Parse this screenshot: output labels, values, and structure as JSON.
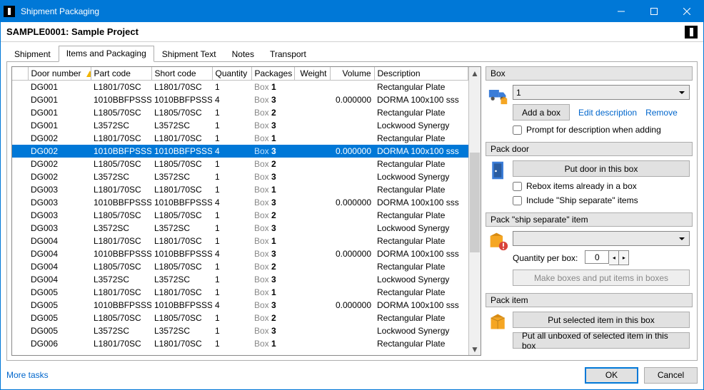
{
  "window": {
    "title": "Shipment Packaging"
  },
  "project": {
    "label": "SAMPLE0001: Sample Project"
  },
  "tabs": {
    "shipment": "Shipment",
    "items": "Items and Packaging",
    "text": "Shipment Text",
    "notes": "Notes",
    "transport": "Transport"
  },
  "grid": {
    "headers": {
      "rowhandle": "",
      "door": "Door number",
      "part": "Part code",
      "shortcode": "Short code",
      "qty": "Quantity",
      "packages": "Packages",
      "weight": "Weight",
      "volume": "Volume",
      "description": "Description"
    },
    "pkg_prefix": "Box ",
    "rows": [
      {
        "door": "DG001",
        "part": "L1801/70SC",
        "short": "L1801/70SC",
        "qty": "1",
        "pkg": "1",
        "weight": "",
        "vol": "",
        "desc": "Rectangular Plate"
      },
      {
        "door": "DG001",
        "part": "1010BBFPSSS",
        "short": "1010BBFPSSS",
        "qty": "4",
        "pkg": "3",
        "weight": "",
        "vol": "0.000000",
        "desc": "DORMA 100x100 sss"
      },
      {
        "door": "DG001",
        "part": "L1805/70SC",
        "short": "L1805/70SC",
        "qty": "1",
        "pkg": "2",
        "weight": "",
        "vol": "",
        "desc": "Rectangular Plate"
      },
      {
        "door": "DG001",
        "part": "L3572SC",
        "short": "L3572SC",
        "qty": "1",
        "pkg": "3",
        "weight": "",
        "vol": "",
        "desc": "Lockwood Synergy"
      },
      {
        "door": "DG002",
        "part": "L1801/70SC",
        "short": "L1801/70SC",
        "qty": "1",
        "pkg": "1",
        "weight": "",
        "vol": "",
        "desc": "Rectangular Plate"
      },
      {
        "door": "DG002",
        "part": "1010BBFPSSS",
        "short": "1010BBFPSSS",
        "qty": "4",
        "pkg": "3",
        "weight": "",
        "vol": "0.000000",
        "desc": "DORMA 100x100 sss",
        "selected": true
      },
      {
        "door": "DG002",
        "part": "L1805/70SC",
        "short": "L1805/70SC",
        "qty": "1",
        "pkg": "2",
        "weight": "",
        "vol": "",
        "desc": "Rectangular Plate"
      },
      {
        "door": "DG002",
        "part": "L3572SC",
        "short": "L3572SC",
        "qty": "1",
        "pkg": "3",
        "weight": "",
        "vol": "",
        "desc": "Lockwood Synergy"
      },
      {
        "door": "DG003",
        "part": "L1801/70SC",
        "short": "L1801/70SC",
        "qty": "1",
        "pkg": "1",
        "weight": "",
        "vol": "",
        "desc": "Rectangular Plate"
      },
      {
        "door": "DG003",
        "part": "1010BBFPSSS",
        "short": "1010BBFPSSS",
        "qty": "4",
        "pkg": "3",
        "weight": "",
        "vol": "0.000000",
        "desc": "DORMA 100x100 sss"
      },
      {
        "door": "DG003",
        "part": "L1805/70SC",
        "short": "L1805/70SC",
        "qty": "1",
        "pkg": "2",
        "weight": "",
        "vol": "",
        "desc": "Rectangular Plate"
      },
      {
        "door": "DG003",
        "part": "L3572SC",
        "short": "L3572SC",
        "qty": "1",
        "pkg": "3",
        "weight": "",
        "vol": "",
        "desc": "Lockwood Synergy"
      },
      {
        "door": "DG004",
        "part": "L1801/70SC",
        "short": "L1801/70SC",
        "qty": "1",
        "pkg": "1",
        "weight": "",
        "vol": "",
        "desc": "Rectangular Plate"
      },
      {
        "door": "DG004",
        "part": "1010BBFPSSS",
        "short": "1010BBFPSSS",
        "qty": "4",
        "pkg": "3",
        "weight": "",
        "vol": "0.000000",
        "desc": "DORMA 100x100 sss"
      },
      {
        "door": "DG004",
        "part": "L1805/70SC",
        "short": "L1805/70SC",
        "qty": "1",
        "pkg": "2",
        "weight": "",
        "vol": "",
        "desc": "Rectangular Plate"
      },
      {
        "door": "DG004",
        "part": "L3572SC",
        "short": "L3572SC",
        "qty": "1",
        "pkg": "3",
        "weight": "",
        "vol": "",
        "desc": "Lockwood Synergy"
      },
      {
        "door": "DG005",
        "part": "L1801/70SC",
        "short": "L1801/70SC",
        "qty": "1",
        "pkg": "1",
        "weight": "",
        "vol": "",
        "desc": "Rectangular Plate"
      },
      {
        "door": "DG005",
        "part": "1010BBFPSSS",
        "short": "1010BBFPSSS",
        "qty": "4",
        "pkg": "3",
        "weight": "",
        "vol": "0.000000",
        "desc": "DORMA 100x100 sss"
      },
      {
        "door": "DG005",
        "part": "L1805/70SC",
        "short": "L1805/70SC",
        "qty": "1",
        "pkg": "2",
        "weight": "",
        "vol": "",
        "desc": "Rectangular Plate"
      },
      {
        "door": "DG005",
        "part": "L3572SC",
        "short": "L3572SC",
        "qty": "1",
        "pkg": "3",
        "weight": "",
        "vol": "",
        "desc": "Lockwood Synergy"
      },
      {
        "door": "DG006",
        "part": "L1801/70SC",
        "short": "L1801/70SC",
        "qty": "1",
        "pkg": "1",
        "weight": "",
        "vol": "",
        "desc": "Rectangular Plate"
      }
    ]
  },
  "side": {
    "box": {
      "title": "Box",
      "selected": "1",
      "add": "Add a box",
      "edit": "Edit description",
      "remove": "Remove",
      "prompt": "Prompt for description when adding"
    },
    "packdoor": {
      "title": "Pack door",
      "put": "Put door in this box",
      "rebox": "Rebox items already in a box",
      "include": "Include \"Ship separate\" items"
    },
    "packship": {
      "title": "Pack \"ship separate\" item",
      "qty_label": "Quantity per box:",
      "qty_value": "0",
      "make": "Make boxes and put items in boxes"
    },
    "packitem": {
      "title": "Pack item",
      "put_selected": "Put selected item in this box",
      "put_all": "Put all unboxed of selected item in this box"
    }
  },
  "footer": {
    "more": "More tasks",
    "ok": "OK",
    "cancel": "Cancel"
  }
}
